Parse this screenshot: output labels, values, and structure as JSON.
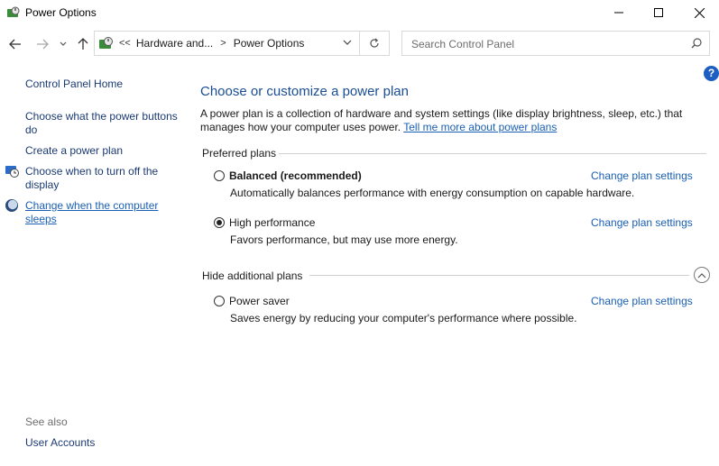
{
  "window": {
    "title": "Power Options"
  },
  "nav": {
    "crumb_prefix": "<<",
    "crumb_parent": "Hardware and...",
    "crumb_sep": ">",
    "crumb_current": "Power Options",
    "search_placeholder": "Search Control Panel"
  },
  "sidebar": {
    "home": "Control Panel Home",
    "items": [
      {
        "label": "Choose what the power buttons do"
      },
      {
        "label": "Create a power plan"
      },
      {
        "label": "Choose when to turn off the display",
        "icon": "clock-monitor-icon"
      },
      {
        "label": "Change when the computer sleeps",
        "icon": "moon-sleep-icon"
      }
    ],
    "see_also": "See also",
    "user_accounts": "User Accounts"
  },
  "main": {
    "title": "Choose or customize a power plan",
    "desc": "A power plan is a collection of hardware and system settings (like display brightness, sleep, etc.) that manages how your computer uses power.",
    "desc_link": "Tell me more about power plans",
    "preferred_label": "Preferred plans",
    "hidden_label": "Hide additional plans",
    "change_link": "Change plan settings",
    "plans": [
      {
        "name": "Balanced (recommended)",
        "desc": "Automatically balances performance with energy consumption on capable hardware.",
        "selected": false
      },
      {
        "name": "High performance",
        "desc": "Favors performance, but may use more energy.",
        "selected": true
      },
      {
        "name": "Power saver",
        "desc": "Saves energy by reducing your computer's performance where possible.",
        "selected": false
      }
    ]
  },
  "colors": {
    "link": "#1a5fb4",
    "heading": "#1a4d94",
    "help": "#1c5ec1"
  }
}
